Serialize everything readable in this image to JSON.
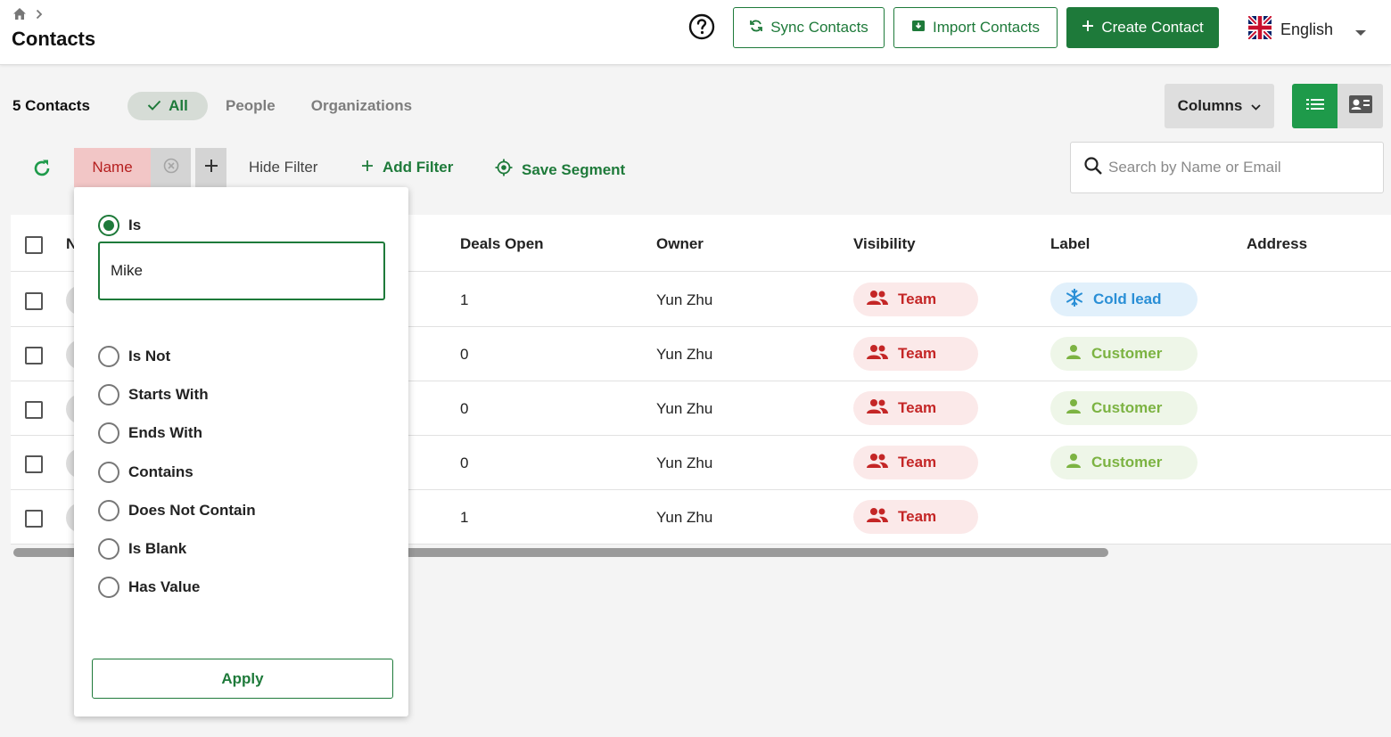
{
  "header": {
    "breadcrumb_icon": "home-icon",
    "title": "Contacts",
    "help_icon": "help-circle-icon",
    "sync_label": "Sync Contacts",
    "import_label": "Import Contacts",
    "create_label": "Create Contact",
    "language": "English",
    "brand_color": "#1e7a3a"
  },
  "toolbar": {
    "count_label": "5 Contacts",
    "segments": {
      "all": "All",
      "people": "People",
      "organizations": "Organizations"
    },
    "columns_label": "Columns"
  },
  "filters": {
    "chip_label": "Name",
    "hide_label": "Hide Filter",
    "add_label": "Add Filter",
    "save_label": "Save Segment",
    "search_placeholder": "Search by Name or Email"
  },
  "table": {
    "headers": {
      "name": "N",
      "deals_open": "Deals Open",
      "owner": "Owner",
      "visibility": "Visibility",
      "label": "Label",
      "address": "Address"
    },
    "rows": [
      {
        "deals": "1",
        "owner": "Yun  Zhu",
        "visibility": "Team",
        "label": "Cold lead",
        "label_type": "cold"
      },
      {
        "deals": "0",
        "owner": "Yun  Zhu",
        "visibility": "Team",
        "label": "Customer",
        "label_type": "customer"
      },
      {
        "deals": "0",
        "owner": "Yun  Zhu",
        "visibility": "Team",
        "label": "Customer",
        "label_type": "customer"
      },
      {
        "deals": "0",
        "owner": "Yun  Zhu",
        "visibility": "Team",
        "label": "Customer",
        "label_type": "customer"
      },
      {
        "deals": "1",
        "owner": "Yun  Zhu",
        "visibility": "Team",
        "label": "",
        "label_type": "none"
      }
    ]
  },
  "popover": {
    "selected_option": "Is",
    "input_value": "Mike",
    "options": [
      "Is Not",
      "Starts With",
      "Ends With",
      "Contains",
      "Does Not Contain",
      "Is Blank",
      "Has Value"
    ],
    "apply_label": "Apply"
  }
}
